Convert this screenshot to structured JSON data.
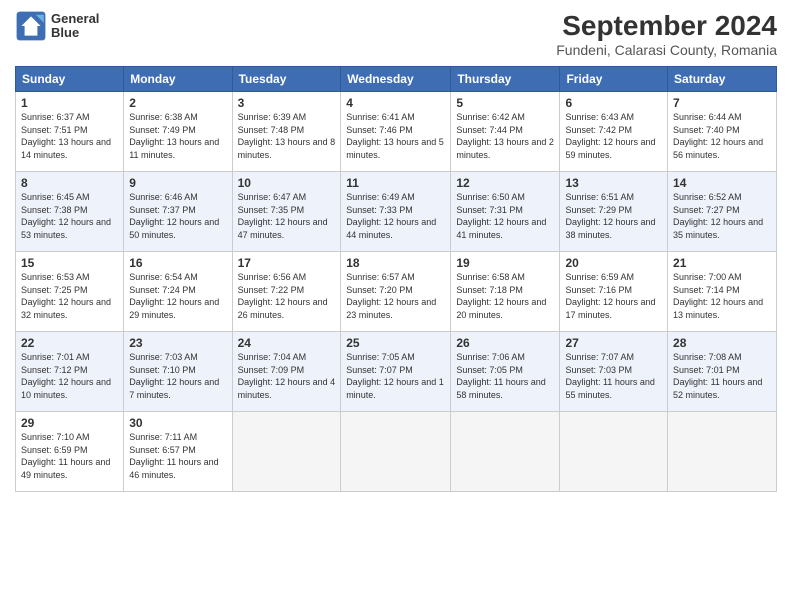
{
  "header": {
    "logo": {
      "line1": "General",
      "line2": "Blue"
    },
    "title": "September 2024",
    "subtitle": "Fundeni, Calarasi County, Romania"
  },
  "days_of_week": [
    "Sunday",
    "Monday",
    "Tuesday",
    "Wednesday",
    "Thursday",
    "Friday",
    "Saturday"
  ],
  "weeks": [
    [
      {
        "day": "1",
        "sunrise": "6:37 AM",
        "sunset": "7:51 PM",
        "daylight": "13 hours and 14 minutes."
      },
      {
        "day": "2",
        "sunrise": "6:38 AM",
        "sunset": "7:49 PM",
        "daylight": "13 hours and 11 minutes."
      },
      {
        "day": "3",
        "sunrise": "6:39 AM",
        "sunset": "7:48 PM",
        "daylight": "13 hours and 8 minutes."
      },
      {
        "day": "4",
        "sunrise": "6:41 AM",
        "sunset": "7:46 PM",
        "daylight": "13 hours and 5 minutes."
      },
      {
        "day": "5",
        "sunrise": "6:42 AM",
        "sunset": "7:44 PM",
        "daylight": "13 hours and 2 minutes."
      },
      {
        "day": "6",
        "sunrise": "6:43 AM",
        "sunset": "7:42 PM",
        "daylight": "12 hours and 59 minutes."
      },
      {
        "day": "7",
        "sunrise": "6:44 AM",
        "sunset": "7:40 PM",
        "daylight": "12 hours and 56 minutes."
      }
    ],
    [
      {
        "day": "8",
        "sunrise": "6:45 AM",
        "sunset": "7:38 PM",
        "daylight": "12 hours and 53 minutes."
      },
      {
        "day": "9",
        "sunrise": "6:46 AM",
        "sunset": "7:37 PM",
        "daylight": "12 hours and 50 minutes."
      },
      {
        "day": "10",
        "sunrise": "6:47 AM",
        "sunset": "7:35 PM",
        "daylight": "12 hours and 47 minutes."
      },
      {
        "day": "11",
        "sunrise": "6:49 AM",
        "sunset": "7:33 PM",
        "daylight": "12 hours and 44 minutes."
      },
      {
        "day": "12",
        "sunrise": "6:50 AM",
        "sunset": "7:31 PM",
        "daylight": "12 hours and 41 minutes."
      },
      {
        "day": "13",
        "sunrise": "6:51 AM",
        "sunset": "7:29 PM",
        "daylight": "12 hours and 38 minutes."
      },
      {
        "day": "14",
        "sunrise": "6:52 AM",
        "sunset": "7:27 PM",
        "daylight": "12 hours and 35 minutes."
      }
    ],
    [
      {
        "day": "15",
        "sunrise": "6:53 AM",
        "sunset": "7:25 PM",
        "daylight": "12 hours and 32 minutes."
      },
      {
        "day": "16",
        "sunrise": "6:54 AM",
        "sunset": "7:24 PM",
        "daylight": "12 hours and 29 minutes."
      },
      {
        "day": "17",
        "sunrise": "6:56 AM",
        "sunset": "7:22 PM",
        "daylight": "12 hours and 26 minutes."
      },
      {
        "day": "18",
        "sunrise": "6:57 AM",
        "sunset": "7:20 PM",
        "daylight": "12 hours and 23 minutes."
      },
      {
        "day": "19",
        "sunrise": "6:58 AM",
        "sunset": "7:18 PM",
        "daylight": "12 hours and 20 minutes."
      },
      {
        "day": "20",
        "sunrise": "6:59 AM",
        "sunset": "7:16 PM",
        "daylight": "12 hours and 17 minutes."
      },
      {
        "day": "21",
        "sunrise": "7:00 AM",
        "sunset": "7:14 PM",
        "daylight": "12 hours and 13 minutes."
      }
    ],
    [
      {
        "day": "22",
        "sunrise": "7:01 AM",
        "sunset": "7:12 PM",
        "daylight": "12 hours and 10 minutes."
      },
      {
        "day": "23",
        "sunrise": "7:03 AM",
        "sunset": "7:10 PM",
        "daylight": "12 hours and 7 minutes."
      },
      {
        "day": "24",
        "sunrise": "7:04 AM",
        "sunset": "7:09 PM",
        "daylight": "12 hours and 4 minutes."
      },
      {
        "day": "25",
        "sunrise": "7:05 AM",
        "sunset": "7:07 PM",
        "daylight": "12 hours and 1 minute."
      },
      {
        "day": "26",
        "sunrise": "7:06 AM",
        "sunset": "7:05 PM",
        "daylight": "11 hours and 58 minutes."
      },
      {
        "day": "27",
        "sunrise": "7:07 AM",
        "sunset": "7:03 PM",
        "daylight": "11 hours and 55 minutes."
      },
      {
        "day": "28",
        "sunrise": "7:08 AM",
        "sunset": "7:01 PM",
        "daylight": "11 hours and 52 minutes."
      }
    ],
    [
      {
        "day": "29",
        "sunrise": "7:10 AM",
        "sunset": "6:59 PM",
        "daylight": "11 hours and 49 minutes."
      },
      {
        "day": "30",
        "sunrise": "7:11 AM",
        "sunset": "6:57 PM",
        "daylight": "11 hours and 46 minutes."
      },
      null,
      null,
      null,
      null,
      null
    ]
  ],
  "labels": {
    "sunrise": "Sunrise:",
    "sunset": "Sunset:",
    "daylight": "Daylight:"
  }
}
